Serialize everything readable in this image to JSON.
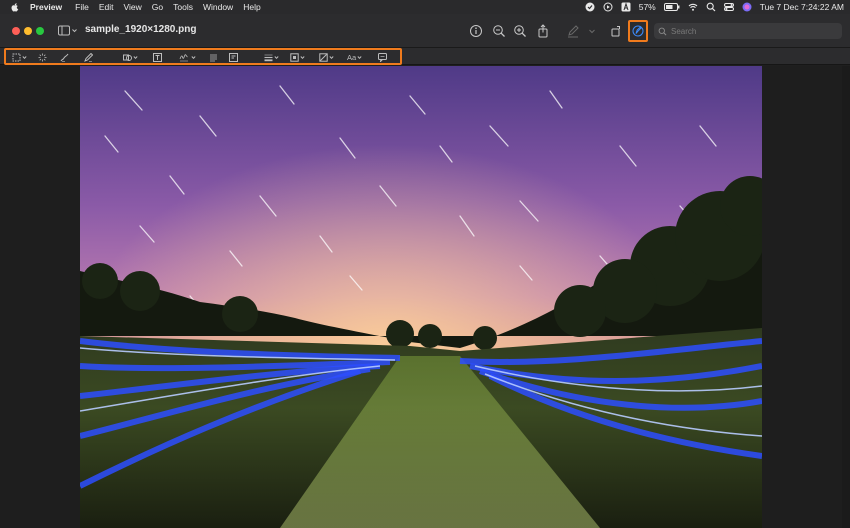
{
  "menubar": {
    "app_name": "Preview",
    "menus": [
      "File",
      "Edit",
      "View",
      "Go",
      "Tools",
      "Window",
      "Help"
    ],
    "battery": "57%",
    "datetime": "Tue 7 Dec  7:24:22 AM",
    "icons": [
      "apple-icon",
      "shield-check-icon",
      "play-circle-icon",
      "text-a-icon",
      "battery-icon",
      "wifi-icon",
      "search-icon",
      "control-center-icon",
      "siri-icon"
    ]
  },
  "window": {
    "title": "sample_1920×1280.png",
    "toolbar_icons": [
      "info-icon",
      "zoom-out-icon",
      "zoom-in-icon",
      "share-icon",
      "highlight-pen-icon",
      "chevron-down-icon",
      "rotate-icon",
      "markup-icon"
    ],
    "search": {
      "placeholder": "Search",
      "value": ""
    }
  },
  "markup_toolbar": {
    "tools": [
      "selection-rect-icon",
      "instant-alpha-icon",
      "sketch-icon",
      "draw-icon",
      "shapes-icon",
      "text-box-icon",
      "sign-icon",
      "note-icon",
      "adjust-color-icon",
      "shape-style-icon",
      "border-color-icon",
      "fill-color-icon",
      "text-style-icon",
      "speech-bubble-icon"
    ],
    "text_style_label": "Aa"
  },
  "colors": {
    "highlight_outline": "#f07b1d",
    "sky_top": "#5a3f8c",
    "sky_horizon": "#f0b070",
    "light_trails": "#2d4dff"
  }
}
